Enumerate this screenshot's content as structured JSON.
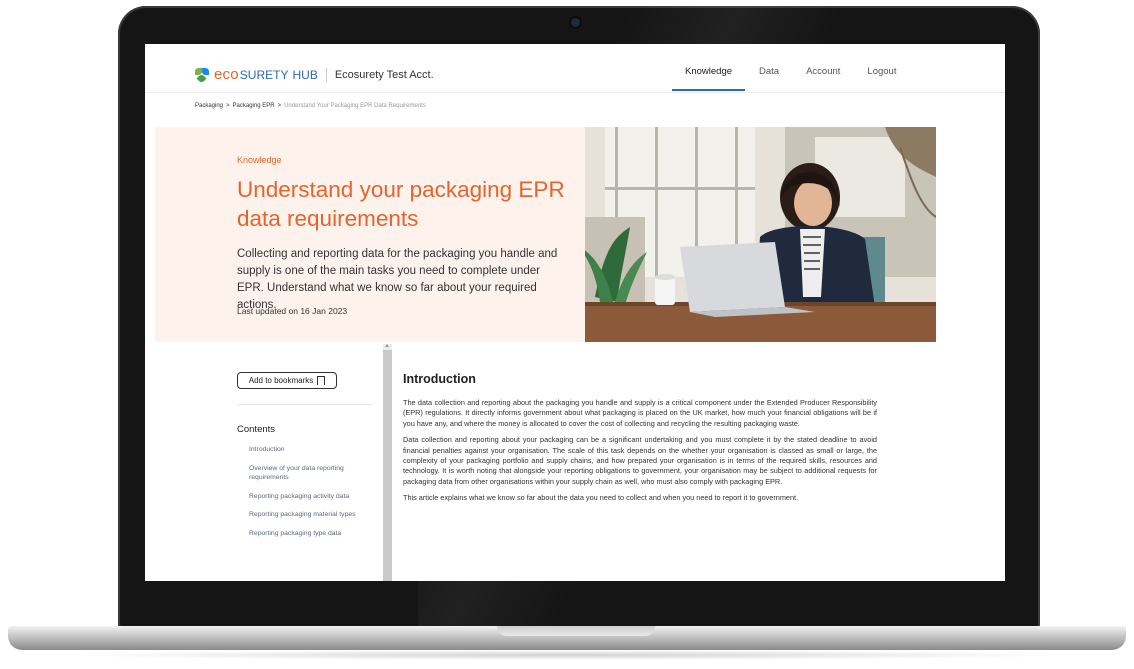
{
  "nav": {
    "brand_eco": "eco",
    "brand_surety": "SURETY",
    "brand_hub": "HUB",
    "account_name": "Ecosurety Test Acct.",
    "links": [
      {
        "label": "Knowledge",
        "active": true
      },
      {
        "label": "Data",
        "active": false
      },
      {
        "label": "Account",
        "active": false
      },
      {
        "label": "Logout",
        "active": false
      }
    ]
  },
  "breadcrumb": {
    "items": [
      "Packaging",
      "Packaging EPR"
    ],
    "separator": ">",
    "current": "Understand Your Packaging EPR Data Requirements"
  },
  "hero": {
    "kicker": "Knowledge",
    "title": "Understand your packaging EPR data requirements",
    "description": "Collecting and reporting data for the packaging you handle and supply is one of the main tasks you need to complete under EPR. Understand what we know so far about your required actions.",
    "updated": "Last updated on 16 Jan 2023"
  },
  "sidebar": {
    "bookmark_label": "Add to bookmarks",
    "contents_title": "Contents",
    "toc": [
      "Introduction",
      "Overview of your data reporting requirements",
      "Reporting packaging activity data",
      "Reporting packaging material types",
      "Reporting packaging type data"
    ]
  },
  "article": {
    "heading": "Introduction",
    "paragraphs": [
      "The data collection and reporting about the packaging you handle and supply is a critical component under the Extended Producer Responsibility (EPR) regulations. It directly informs government about what packaging is placed on the UK market, how much your financial obligations will be if you have any, and where the money is allocated to cover the cost of collecting and recycling the resulting packaging waste.",
      "Data collection and reporting about your packaging can be a significant undertaking and you must complete it by the stated deadline to avoid financial penalties against your organisation. The scale of this task depends on the whether your organisation is classed as small or large, the complexity of your packaging portfolio and supply chains, and how prepared your organisation is in terms of the required skills, resources and technology. It is worth noting that alongside your reporting obligations to government, your organisation may be subject to additional requests for packaging data from other organisations within your supply chain as well, who must also comply with packaging EPR.",
      "This article explains what we know so far about the data you need to collect and when you need to report it to government."
    ]
  },
  "colors": {
    "accent": "#e8632b",
    "brand_blue": "#2b6cb0",
    "hero_bg": "#fdf3ec"
  }
}
